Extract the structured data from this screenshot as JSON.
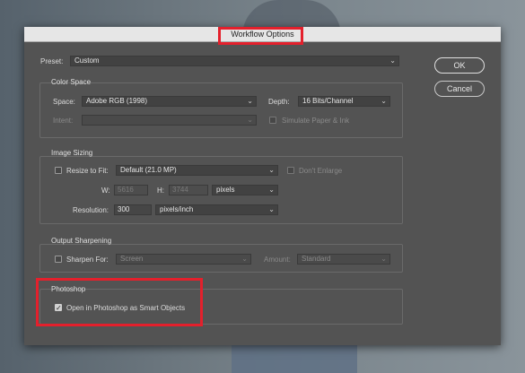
{
  "title": "Workflow Options",
  "preset": {
    "label": "Preset:",
    "value": "Custom"
  },
  "buttons": {
    "ok": "OK",
    "cancel": "Cancel"
  },
  "color_space": {
    "title": "Color Space",
    "space_label": "Space:",
    "space_value": "Adobe RGB (1998)",
    "depth_label": "Depth:",
    "depth_value": "16 Bits/Channel",
    "intent_label": "Intent:",
    "intent_value": "",
    "simulate_label": "Simulate Paper & Ink"
  },
  "image_sizing": {
    "title": "Image Sizing",
    "resize_label": "Resize to Fit:",
    "resize_value": "Default  (21.0 MP)",
    "dont_enlarge_label": "Don't Enlarge",
    "w_label": "W:",
    "w_value": "5616",
    "h_label": "H:",
    "h_value": "3744",
    "size_unit": "pixels",
    "resolution_label": "Resolution:",
    "resolution_value": "300",
    "resolution_unit": "pixels/inch"
  },
  "output_sharpening": {
    "title": "Output Sharpening",
    "sharpen_label": "Sharpen For:",
    "sharpen_value": "Screen",
    "amount_label": "Amount:",
    "amount_value": "Standard"
  },
  "photoshop": {
    "title": "Photoshop",
    "smart_objects_label": "Open in Photoshop as Smart Objects",
    "smart_objects_checked": true
  },
  "colors": {
    "highlight": "#e4202c",
    "dialog_bg": "#535353"
  }
}
